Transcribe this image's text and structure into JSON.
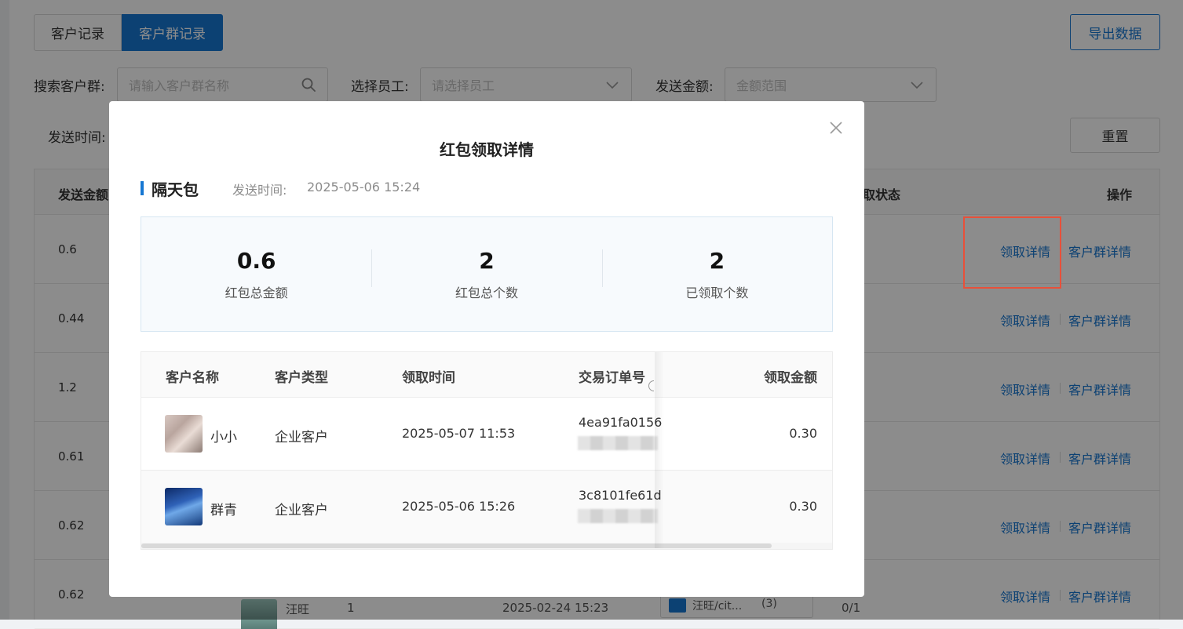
{
  "background": {
    "tabs": [
      {
        "label": "客户记录",
        "active": false
      },
      {
        "label": "客户群记录",
        "active": true
      }
    ],
    "export_label": "导出数据",
    "filters": {
      "search_label": "搜索客户群:",
      "search_placeholder": "请输入客户群名称",
      "staff_label": "选择员工:",
      "staff_placeholder": "请选择员工",
      "amount_label": "发送金额:",
      "amount_placeholder": "金额范围",
      "time_label": "发送时间:"
    },
    "reset_label": "重置",
    "table": {
      "headers": {
        "amount": "发送金额",
        "status": "取状态",
        "action": "操作"
      },
      "rows": [
        {
          "amount": "0.6"
        },
        {
          "amount": "0.44"
        },
        {
          "amount": "1.2"
        },
        {
          "amount": "0.61"
        },
        {
          "amount": "0.62"
        },
        {
          "amount": "0.62"
        }
      ],
      "action_detail": "领取详情",
      "action_group": "客户群详情",
      "peek_name": "汪旺",
      "peek_num": "1",
      "peek_time": "2025-02-24 15:23",
      "peek_tag": "汪旺/cit...",
      "peek_count": "(3)",
      "peek_ratio": "0/1"
    }
  },
  "modal": {
    "title": "红包领取详情",
    "pack_name": "隔天包",
    "send_time_label": "发送时间:",
    "send_time": "2025-05-06 15:24",
    "stats": [
      {
        "value": "0.6",
        "label": "红包总金额"
      },
      {
        "value": "2",
        "label": "红包总个数"
      },
      {
        "value": "2",
        "label": "已领取个数"
      }
    ],
    "table": {
      "headers": {
        "name": "客户名称",
        "type": "客户类型",
        "time": "领取时间",
        "order": "交易订单号",
        "amount": "领取金额"
      },
      "rows": [
        {
          "name": "小小",
          "type": "企业客户",
          "time": "2025-05-07 11:53",
          "order": "4ea91fa0156",
          "amount": "0.30"
        },
        {
          "name": "群青",
          "type": "企业客户",
          "time": "2025-05-06 15:26",
          "order": "3c8101fe61d",
          "amount": "0.30"
        }
      ]
    }
  }
}
